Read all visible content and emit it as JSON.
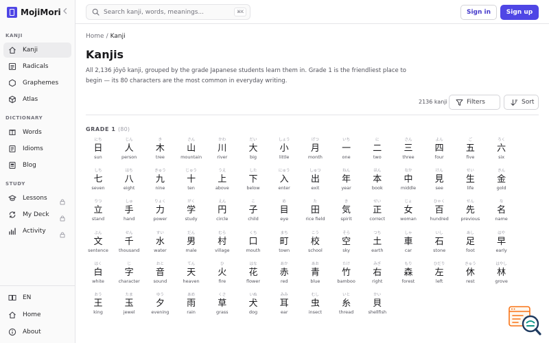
{
  "brand": {
    "name": "MojiMori"
  },
  "sidebar": {
    "sections": [
      {
        "heading": "KANJI",
        "items": [
          {
            "label": "Kanji",
            "icon": "home-icon",
            "active": true
          },
          {
            "label": "Radicals",
            "icon": "radicals-icon"
          },
          {
            "label": "Graphemes",
            "icon": "graphemes-icon"
          },
          {
            "label": "Atlas",
            "icon": "atlas-icon"
          }
        ]
      },
      {
        "heading": "DICTIONARY",
        "items": [
          {
            "label": "Words",
            "icon": "words-icon"
          },
          {
            "label": "Idioms",
            "icon": "idioms-icon"
          },
          {
            "label": "Blog",
            "icon": "blog-icon"
          }
        ]
      },
      {
        "heading": "STUDY",
        "items": [
          {
            "label": "Lessons",
            "icon": "lessons-icon",
            "locked": true
          },
          {
            "label": "My Deck",
            "icon": "deck-icon",
            "locked": true
          },
          {
            "label": "Activity",
            "icon": "activity-icon",
            "locked": true
          }
        ]
      }
    ],
    "bottom": [
      {
        "label": "EN",
        "icon": "language-icon"
      },
      {
        "label": "Home",
        "icon": "home-icon"
      },
      {
        "label": "About",
        "icon": "info-icon"
      }
    ]
  },
  "header": {
    "search_placeholder": "Search kanji, words, meanings...",
    "shortcut": "⌘K",
    "signin_label": "Sign in",
    "signup_label": "Sign up"
  },
  "breadcrumb": {
    "home": "Home",
    "separator": "/",
    "current": "Kanji"
  },
  "page": {
    "title": "Kanjis",
    "description": "All 2,136 jōyō kanji, grouped by the grade Japanese students learn them in. Grade 1 is the friendliest place to begin — its 80 characters are the most common in everyday writing."
  },
  "toolbar": {
    "count": "2136 kanji",
    "filters_label": "Filters",
    "sort_label": "Sort"
  },
  "grade": {
    "label": "GRADE 1",
    "count": "(80)"
  },
  "colors": {
    "accent": "#4f46e5",
    "text": "#18181b",
    "muted": "#71717a",
    "border": "#e4e4e7"
  },
  "kanji": [
    {
      "kanji": "日",
      "reading": "にち",
      "meaning": "sun"
    },
    {
      "kanji": "人",
      "reading": "じん",
      "meaning": "person"
    },
    {
      "kanji": "木",
      "reading": "き",
      "meaning": "tree"
    },
    {
      "kanji": "山",
      "reading": "さん",
      "meaning": "mountain"
    },
    {
      "kanji": "川",
      "reading": "かわ",
      "meaning": "river"
    },
    {
      "kanji": "大",
      "reading": "だい",
      "meaning": "big"
    },
    {
      "kanji": "小",
      "reading": "しょう",
      "meaning": "little"
    },
    {
      "kanji": "月",
      "reading": "げつ",
      "meaning": "month"
    },
    {
      "kanji": "一",
      "reading": "いち",
      "meaning": "one"
    },
    {
      "kanji": "二",
      "reading": "に",
      "meaning": "two"
    },
    {
      "kanji": "三",
      "reading": "さん",
      "meaning": "three"
    },
    {
      "kanji": "四",
      "reading": "よん",
      "meaning": "four"
    },
    {
      "kanji": "五",
      "reading": "ご",
      "meaning": "five"
    },
    {
      "kanji": "六",
      "reading": "ろく",
      "meaning": "six"
    },
    {
      "kanji": "七",
      "reading": "しち",
      "meaning": "seven"
    },
    {
      "kanji": "八",
      "reading": "はち",
      "meaning": "eight"
    },
    {
      "kanji": "九",
      "reading": "きゅう",
      "meaning": "nine"
    },
    {
      "kanji": "十",
      "reading": "じゅう",
      "meaning": "ten"
    },
    {
      "kanji": "上",
      "reading": "うえ",
      "meaning": "above"
    },
    {
      "kanji": "下",
      "reading": "した",
      "meaning": "below"
    },
    {
      "kanji": "入",
      "reading": "にゅう",
      "meaning": "enter"
    },
    {
      "kanji": "出",
      "reading": "しゅつ",
      "meaning": "exit"
    },
    {
      "kanji": "年",
      "reading": "ねん",
      "meaning": "year"
    },
    {
      "kanji": "本",
      "reading": "ほん",
      "meaning": "book"
    },
    {
      "kanji": "中",
      "reading": "なか",
      "meaning": "middle"
    },
    {
      "kanji": "見",
      "reading": "けん",
      "meaning": "see"
    },
    {
      "kanji": "生",
      "reading": "せい",
      "meaning": "life"
    },
    {
      "kanji": "金",
      "reading": "きん",
      "meaning": "gold"
    },
    {
      "kanji": "立",
      "reading": "りつ",
      "meaning": "stand"
    },
    {
      "kanji": "手",
      "reading": "しゅ",
      "meaning": "hand"
    },
    {
      "kanji": "力",
      "reading": "りょく",
      "meaning": "power"
    },
    {
      "kanji": "学",
      "reading": "がく",
      "meaning": "study"
    },
    {
      "kanji": "円",
      "reading": "えん",
      "meaning": "circle"
    },
    {
      "kanji": "子",
      "reading": "こ",
      "meaning": "child"
    },
    {
      "kanji": "目",
      "reading": "め",
      "meaning": "eye"
    },
    {
      "kanji": "田",
      "reading": "た",
      "meaning": "rice field"
    },
    {
      "kanji": "気",
      "reading": "き",
      "meaning": "spirit"
    },
    {
      "kanji": "正",
      "reading": "せい",
      "meaning": "correct"
    },
    {
      "kanji": "女",
      "reading": "じょ",
      "meaning": "woman"
    },
    {
      "kanji": "百",
      "reading": "ひゃく",
      "meaning": "hundred"
    },
    {
      "kanji": "先",
      "reading": "せん",
      "meaning": "previous"
    },
    {
      "kanji": "名",
      "reading": "な",
      "meaning": "name"
    },
    {
      "kanji": "文",
      "reading": "ぶん",
      "meaning": "sentence"
    },
    {
      "kanji": "千",
      "reading": "せん",
      "meaning": "thousand"
    },
    {
      "kanji": "水",
      "reading": "すい",
      "meaning": "water"
    },
    {
      "kanji": "男",
      "reading": "だん",
      "meaning": "male"
    },
    {
      "kanji": "村",
      "reading": "むら",
      "meaning": "village"
    },
    {
      "kanji": "口",
      "reading": "くち",
      "meaning": "mouth"
    },
    {
      "kanji": "町",
      "reading": "まち",
      "meaning": "town"
    },
    {
      "kanji": "校",
      "reading": "こう",
      "meaning": "school"
    },
    {
      "kanji": "空",
      "reading": "そら",
      "meaning": "sky"
    },
    {
      "kanji": "土",
      "reading": "つち",
      "meaning": "earth"
    },
    {
      "kanji": "車",
      "reading": "しゃ",
      "meaning": "car"
    },
    {
      "kanji": "石",
      "reading": "いし",
      "meaning": "stone"
    },
    {
      "kanji": "足",
      "reading": "あし",
      "meaning": "foot"
    },
    {
      "kanji": "早",
      "reading": "はや",
      "meaning": "early"
    },
    {
      "kanji": "白",
      "reading": "はく",
      "meaning": "white"
    },
    {
      "kanji": "字",
      "reading": "じ",
      "meaning": "character"
    },
    {
      "kanji": "音",
      "reading": "おと",
      "meaning": "sound"
    },
    {
      "kanji": "天",
      "reading": "てん",
      "meaning": "heaven"
    },
    {
      "kanji": "火",
      "reading": "ひ",
      "meaning": "fire"
    },
    {
      "kanji": "花",
      "reading": "はな",
      "meaning": "flower"
    },
    {
      "kanji": "赤",
      "reading": "あか",
      "meaning": "red"
    },
    {
      "kanji": "青",
      "reading": "あお",
      "meaning": "blue"
    },
    {
      "kanji": "竹",
      "reading": "たけ",
      "meaning": "bamboo"
    },
    {
      "kanji": "右",
      "reading": "みぎ",
      "meaning": "right"
    },
    {
      "kanji": "森",
      "reading": "もり",
      "meaning": "forest"
    },
    {
      "kanji": "左",
      "reading": "ひだり",
      "meaning": "left"
    },
    {
      "kanji": "休",
      "reading": "きゅう",
      "meaning": "rest"
    },
    {
      "kanji": "林",
      "reading": "はやし",
      "meaning": "grove"
    },
    {
      "kanji": "王",
      "reading": "おう",
      "meaning": "king"
    },
    {
      "kanji": "玉",
      "reading": "たま",
      "meaning": "jewel"
    },
    {
      "kanji": "夕",
      "reading": "ゆう",
      "meaning": "evening"
    },
    {
      "kanji": "雨",
      "reading": "あめ",
      "meaning": "rain"
    },
    {
      "kanji": "草",
      "reading": "くさ",
      "meaning": "grass"
    },
    {
      "kanji": "犬",
      "reading": "いぬ",
      "meaning": "dog"
    },
    {
      "kanji": "耳",
      "reading": "みみ",
      "meaning": "ear"
    },
    {
      "kanji": "虫",
      "reading": "むし",
      "meaning": "insect"
    },
    {
      "kanji": "糸",
      "reading": "いと",
      "meaning": "thread"
    },
    {
      "kanji": "貝",
      "reading": "かい",
      "meaning": "shellfish"
    }
  ]
}
